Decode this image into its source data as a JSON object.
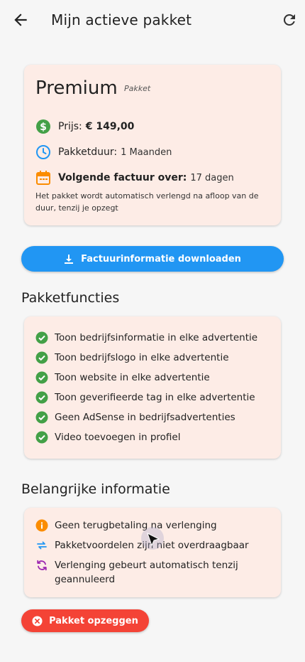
{
  "appbar": {
    "title": "Mijn actieve pakket",
    "back_icon": "arrow-left-icon",
    "refresh_icon": "refresh-icon"
  },
  "plan": {
    "name": "Premium",
    "tag": "Pakket",
    "price_label": "Prijs:",
    "price_value": "€ 149,00",
    "duration_label": "Pakketduur:",
    "duration_value": "1 Maanden",
    "next_invoice_label": "Volgende factuur over:",
    "next_invoice_value": "17 dagen",
    "note": "Het pakket wordt automatisch verlengd na afloop van de duur, tenzij je opzegt"
  },
  "download_button": {
    "label": "Factuurinformatie downloaden"
  },
  "features": {
    "title": "Pakketfuncties",
    "items": [
      "Toon bedrijfsinformatie in elke advertentie",
      "Toon bedrijfslogo in elke advertentie",
      "Toon website in elke advertentie",
      "Toon geverifieerde tag in elke advertentie",
      "Geen AdSense in bedrijfsadvertenties",
      "Video toevoegen in profiel"
    ]
  },
  "important": {
    "title": "Belangrijke informatie",
    "items": [
      "Geen terugbetaling na verlenging",
      "Pakketvoordelen zijn niet overdraagbaar",
      "Verlenging gebeurt automatisch tenzij geannuleerd"
    ]
  },
  "cancel_button": {
    "label": "Pakket opzeggen"
  },
  "colors": {
    "card_bg": "#fdece6",
    "primary": "#2196f3",
    "danger": "#f44336",
    "success": "#43a047",
    "warning": "#fb8c00",
    "purple": "#9c27b0"
  }
}
